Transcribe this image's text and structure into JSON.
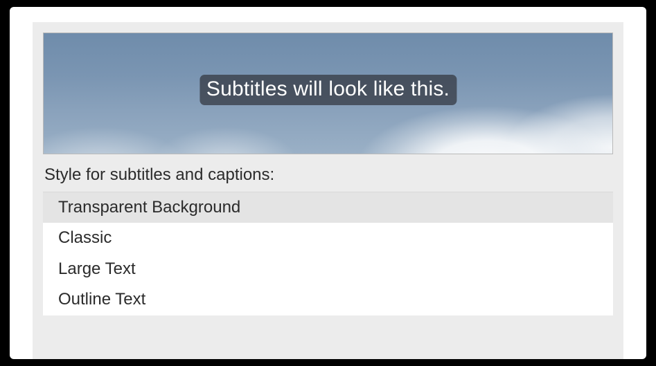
{
  "preview": {
    "subtitle_sample": "Subtitles will look like this."
  },
  "section_label": "Style for subtitles and captions:",
  "styles": [
    {
      "label": "Transparent Background",
      "selected": true
    },
    {
      "label": "Classic",
      "selected": false
    },
    {
      "label": "Large Text",
      "selected": false
    },
    {
      "label": "Outline Text",
      "selected": false
    }
  ]
}
